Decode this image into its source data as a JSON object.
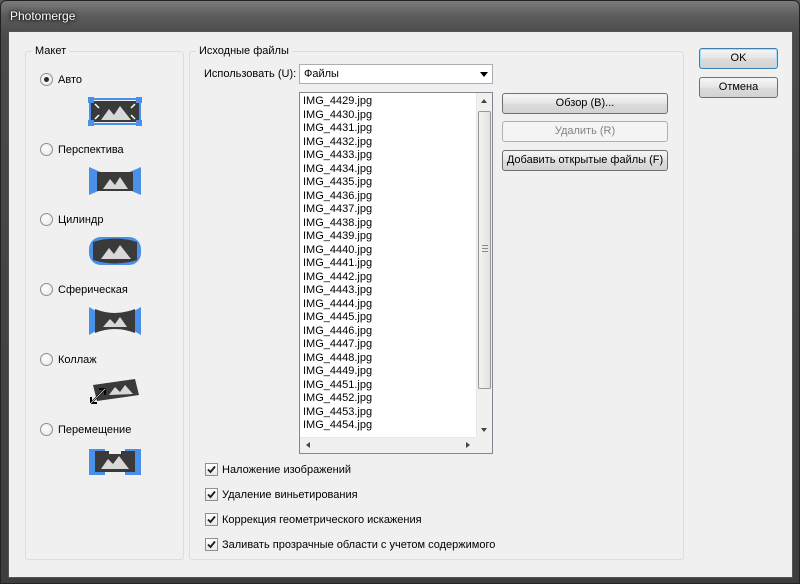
{
  "window": {
    "title": "Photomerge"
  },
  "layout": {
    "legend": "Макет",
    "options": [
      {
        "label": "Авто",
        "selected": true,
        "icon": "auto-layout-icon"
      },
      {
        "label": "Перспектива",
        "selected": false,
        "icon": "perspective-layout-icon"
      },
      {
        "label": "Цилиндр",
        "selected": false,
        "icon": "cylinder-layout-icon"
      },
      {
        "label": "Сферическая",
        "selected": false,
        "icon": "spherical-layout-icon"
      },
      {
        "label": "Коллаж",
        "selected": false,
        "icon": "collage-layout-icon"
      },
      {
        "label": "Перемещение",
        "selected": false,
        "icon": "reposition-layout-icon"
      }
    ]
  },
  "source": {
    "legend": "Исходные файлы",
    "use_label": "Использовать (U):",
    "use_value": "Файлы",
    "files": [
      "IMG_4429.jpg",
      "IMG_4430.jpg",
      "IMG_4431.jpg",
      "IMG_4432.jpg",
      "IMG_4433.jpg",
      "IMG_4434.jpg",
      "IMG_4435.jpg",
      "IMG_4436.jpg",
      "IMG_4437.jpg",
      "IMG_4438.jpg",
      "IMG_4439.jpg",
      "IMG_4440.jpg",
      "IMG_4441.jpg",
      "IMG_4442.jpg",
      "IMG_4443.jpg",
      "IMG_4444.jpg",
      "IMG_4445.jpg",
      "IMG_4446.jpg",
      "IMG_4447.jpg",
      "IMG_4448.jpg",
      "IMG_4449.jpg",
      "IMG_4451.jpg",
      "IMG_4452.jpg",
      "IMG_4453.jpg",
      "IMG_4454.jpg"
    ],
    "browse_label": "Обзор (B)...",
    "remove_label": "Удалить (R)",
    "add_open_label": "Добавить открытые файлы (F)"
  },
  "options": [
    {
      "label": "Наложение изображений",
      "checked": true
    },
    {
      "label": "Удаление виньетирования",
      "checked": true
    },
    {
      "label": "Коррекция геометрического искажения",
      "checked": true
    },
    {
      "label": "Заливать прозрачные области с учетом содержимого",
      "checked": true
    }
  ],
  "buttons": {
    "ok": "OK",
    "cancel": "Отмена"
  },
  "colors": {
    "accent_blue": "#4a8fe8",
    "thumb_dark": "#3a3a3a"
  }
}
